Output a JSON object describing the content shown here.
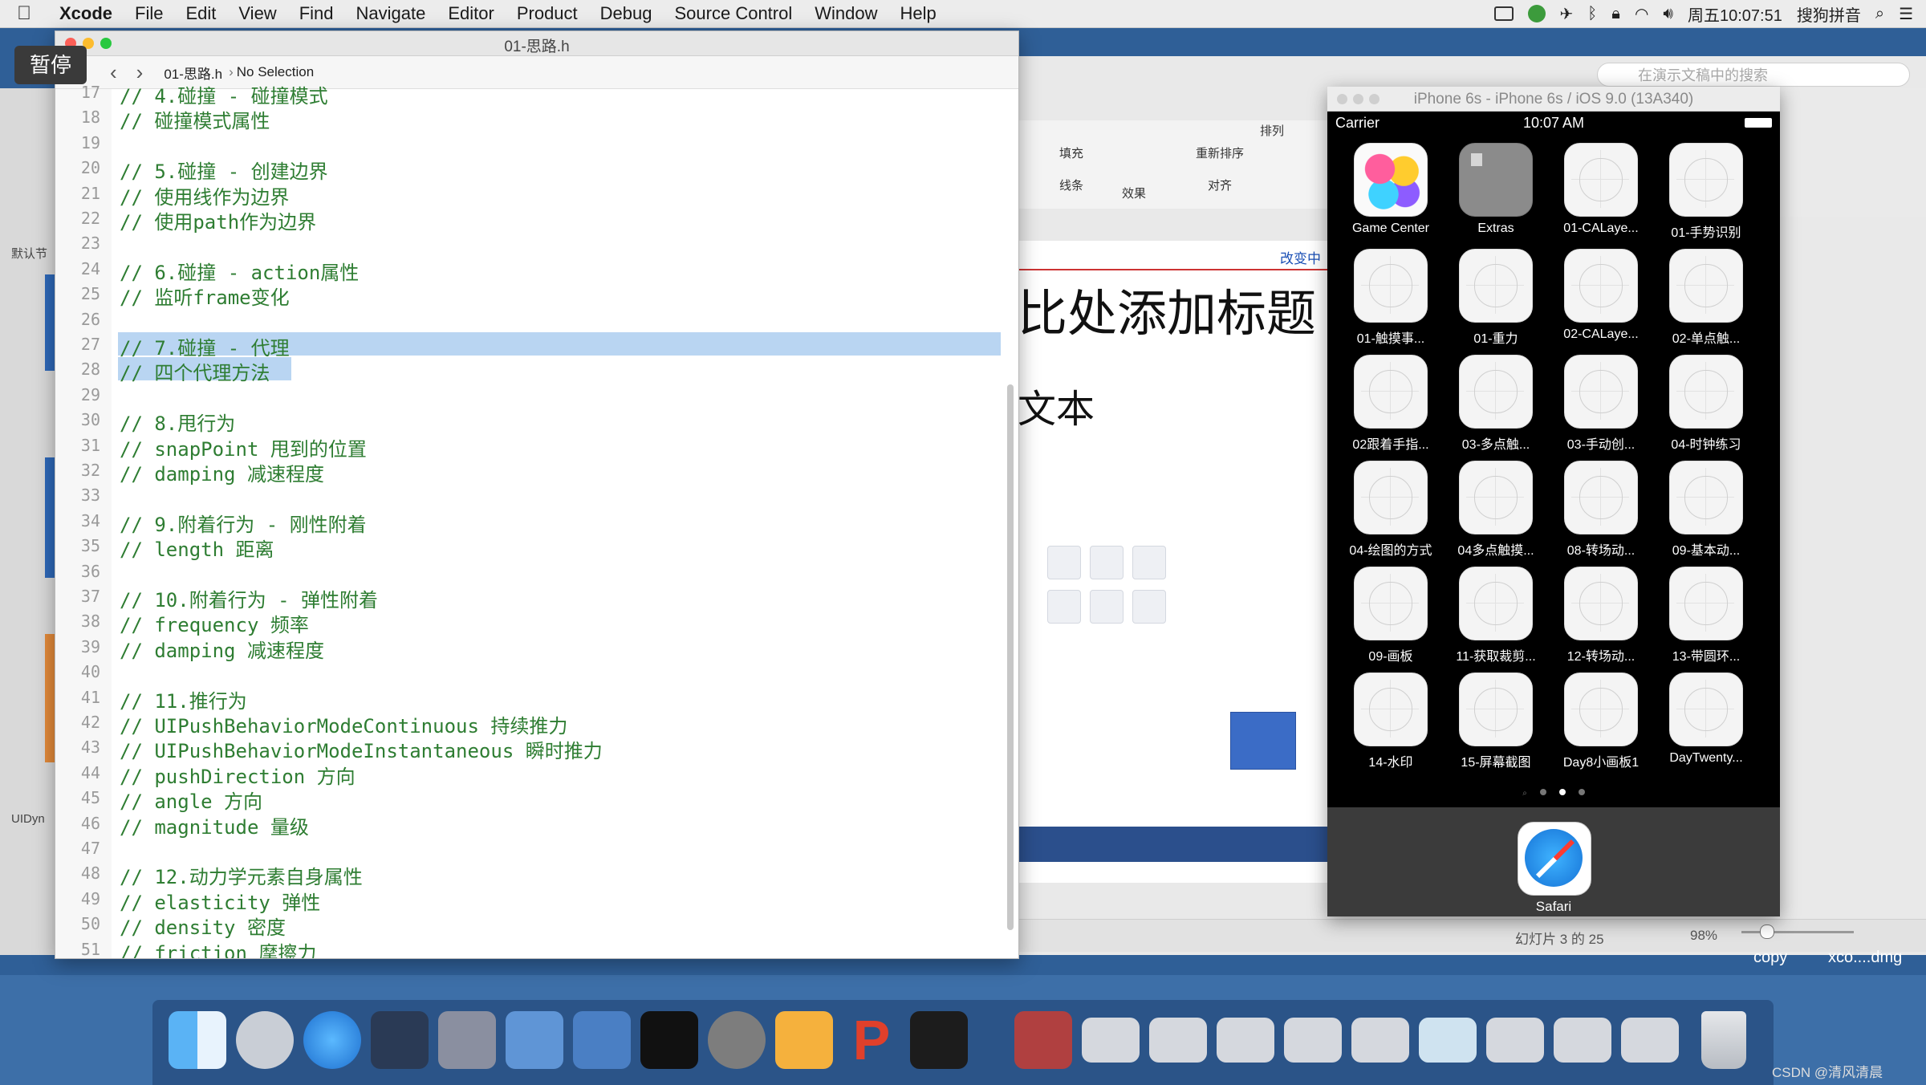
{
  "menubar": {
    "items": [
      "Xcode",
      "File",
      "Edit",
      "View",
      "Find",
      "Navigate",
      "Editor",
      "Product",
      "Debug",
      "Source Control",
      "Window",
      "Help"
    ],
    "clock": "周五10:07:51",
    "input_method": "搜狗拼音"
  },
  "pause_label": "暂停",
  "xcode": {
    "window_title": "01-思路.h",
    "breadcrumb_file": "01-思路.h",
    "breadcrumb_selection": "No Selection",
    "lines": [
      {
        "n": "17",
        "t": "// 4.碰撞 - 碰撞模式"
      },
      {
        "n": "18",
        "t": "// 碰撞模式属性"
      },
      {
        "n": "19",
        "t": ""
      },
      {
        "n": "20",
        "t": "// 5.碰撞 - 创建边界"
      },
      {
        "n": "21",
        "t": "// 使用线作为边界"
      },
      {
        "n": "22",
        "t": "// 使用path作为边界"
      },
      {
        "n": "23",
        "t": ""
      },
      {
        "n": "24",
        "t": "// 6.碰撞 - action属性"
      },
      {
        "n": "25",
        "t": "// 监听frame变化"
      },
      {
        "n": "26",
        "t": ""
      },
      {
        "n": "27",
        "t": "// 7.碰撞 - 代理"
      },
      {
        "n": "28",
        "t": "// 四个代理方法"
      },
      {
        "n": "29",
        "t": ""
      },
      {
        "n": "30",
        "t": "// 8.甩行为"
      },
      {
        "n": "31",
        "t": "// snapPoint 甩到的位置"
      },
      {
        "n": "32",
        "t": "// damping 减速程度"
      },
      {
        "n": "33",
        "t": ""
      },
      {
        "n": "34",
        "t": "// 9.附着行为 - 刚性附着"
      },
      {
        "n": "35",
        "t": "// length 距离"
      },
      {
        "n": "36",
        "t": ""
      },
      {
        "n": "37",
        "t": "// 10.附着行为 - 弹性附着"
      },
      {
        "n": "38",
        "t": "// frequency 频率"
      },
      {
        "n": "39",
        "t": "// damping 减速程度"
      },
      {
        "n": "40",
        "t": ""
      },
      {
        "n": "41",
        "t": "// 11.推行为"
      },
      {
        "n": "42",
        "t": "// UIPushBehaviorModeContinuous 持续推力"
      },
      {
        "n": "43",
        "t": "// UIPushBehaviorModeInstantaneous 瞬时推力"
      },
      {
        "n": "44",
        "t": "// pushDirection 方向"
      },
      {
        "n": "45",
        "t": "// angle 方向"
      },
      {
        "n": "46",
        "t": "// magnitude 量级"
      },
      {
        "n": "47",
        "t": ""
      },
      {
        "n": "48",
        "t": "// 12.动力学元素自身属性"
      },
      {
        "n": "49",
        "t": "// elasticity 弹性"
      },
      {
        "n": "50",
        "t": "// density 密度"
      },
      {
        "n": "51",
        "t": "// friction 摩擦力"
      }
    ]
  },
  "keynote": {
    "search_placeholder": "在演示文稿中的搜索",
    "toolbar": {
      "fill": "填充",
      "line": "线条",
      "effect": "效果",
      "reorder": "重新排序",
      "align": "对齐",
      "arrange": "排列"
    },
    "change_label": "改变中",
    "slide_title": "比处添加标题",
    "slide_text": "文本",
    "status_slide": "幻灯片 3 的 25",
    "zoom": "98%",
    "sidebar_labels": [
      "默认节",
      "UIDyn"
    ]
  },
  "simulator": {
    "title": "iPhone 6s - iPhone 6s / iOS 9.0 (13A340)",
    "carrier": "Carrier",
    "time": "10:07 AM",
    "apps": [
      "Game Center",
      "Extras",
      "01-CALaye...",
      "01-手势识别",
      "01-触摸事...",
      "01-重力",
      "02-CALaye...",
      "02-单点触...",
      "02跟着手指...",
      "03-多点触...",
      "03-手动创...",
      "04-时钟练习",
      "04-绘图的方式",
      "04多点触摸...",
      "08-转场动...",
      "09-基本动...",
      "09-画板",
      "11-获取裁剪...",
      "12-转场动...",
      "13-带圆环...",
      "14-水印",
      "15-屏幕截图",
      "Day8小画板1",
      "DayTwenty..."
    ],
    "dock_app": "Safari"
  },
  "desktop": {
    "label_copy": "copy",
    "label_dmg": "xco....dmg",
    "credit": "CSDN @清风清晨"
  },
  "colors": {
    "comment": "#2e7d32",
    "selection": "#b9d5f2",
    "desktop": "#2f5f97"
  }
}
